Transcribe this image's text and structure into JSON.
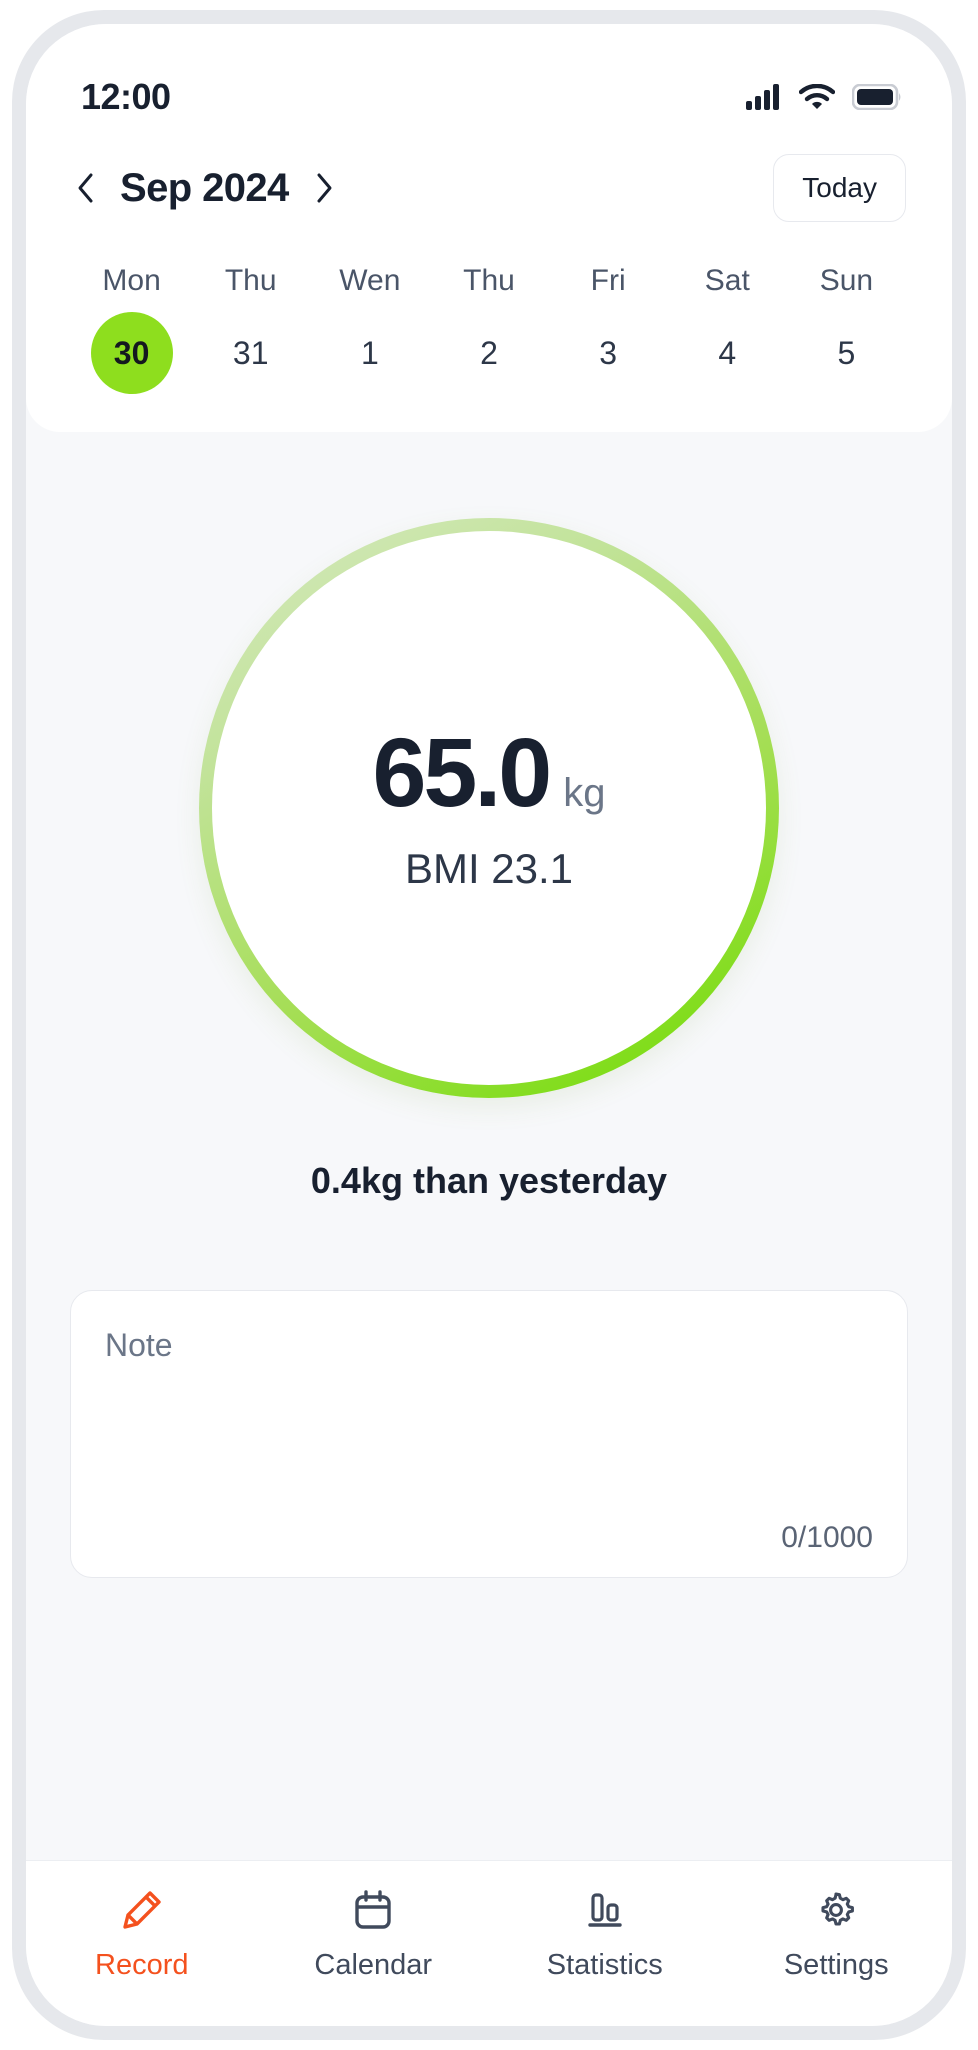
{
  "statusbar": {
    "time": "12:00",
    "icons": [
      "signal-icon",
      "wifi-icon",
      "battery-icon"
    ]
  },
  "calendar": {
    "prev_label": "‹",
    "next_label": "›",
    "month": "Sep 2024",
    "today_label": "Today",
    "weekdays": [
      "Mon",
      "Thu",
      "Wen",
      "Thu",
      "Fri",
      "Sat",
      "Sun"
    ],
    "dates": [
      "30",
      "31",
      "1",
      "2",
      "3",
      "4",
      "5"
    ],
    "selected_index": 0,
    "selected_color": "#8ede1e"
  },
  "record": {
    "weight_value": "65.0",
    "weight_unit": "kg",
    "bmi": "BMI 23.1",
    "delta": "0.4kg than yesterday",
    "ring_gradient_start": "#d7e9c2",
    "ring_gradient_end": "#7fdd18"
  },
  "note": {
    "placeholder": "Note",
    "value": "",
    "counter": "0/1000"
  },
  "tabs": [
    {
      "label": "Record",
      "icon": "pencil-icon",
      "active": true
    },
    {
      "label": "Calendar",
      "icon": "calendar-icon",
      "active": false
    },
    {
      "label": "Statistics",
      "icon": "bar-chart-icon",
      "active": false
    },
    {
      "label": "Settings",
      "icon": "gear-icon",
      "active": false
    }
  ],
  "theme": {
    "accent": "#f4511e",
    "green": "#8ede1e",
    "text_dark": "#18202f",
    "text_muted": "#6b7688",
    "bg": "#f7f8fa"
  }
}
